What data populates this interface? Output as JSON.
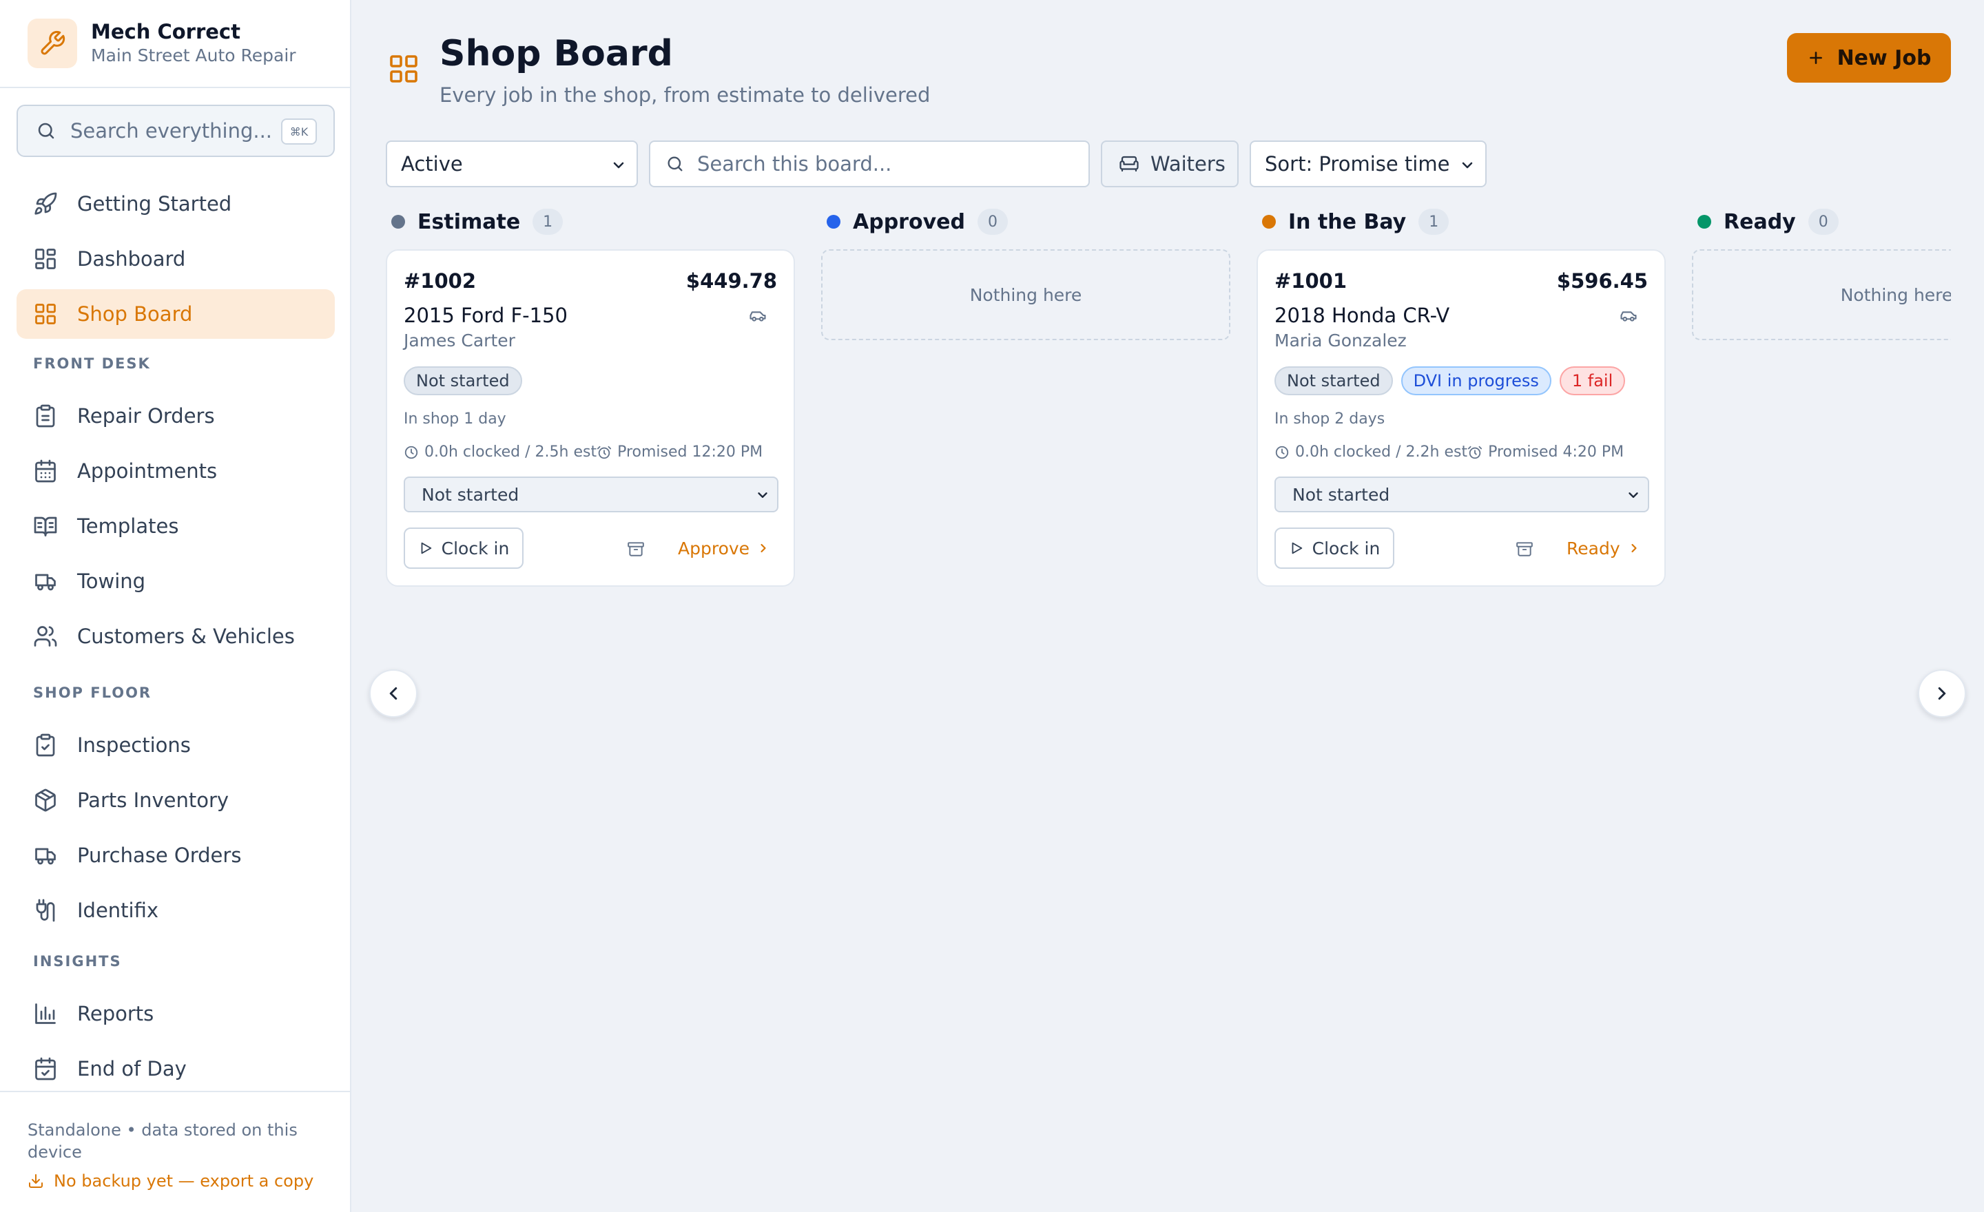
{
  "brand": {
    "name": "Mech Correct",
    "subtitle": "Main Street Auto Repair"
  },
  "sidebar": {
    "search_placeholder": "Search everything...",
    "search_shortcut": "⌘K",
    "items_top": [
      {
        "label": "Getting Started",
        "icon": "rocket-icon"
      },
      {
        "label": "Dashboard",
        "icon": "dashboard-icon"
      },
      {
        "label": "Shop Board",
        "icon": "grid-icon",
        "active": true
      }
    ],
    "sections": [
      {
        "title": "FRONT DESK",
        "items": [
          {
            "label": "Repair Orders",
            "icon": "clipboard-icon"
          },
          {
            "label": "Appointments",
            "icon": "calendar-icon"
          },
          {
            "label": "Templates",
            "icon": "book-icon"
          },
          {
            "label": "Towing",
            "icon": "truck-icon"
          },
          {
            "label": "Customers & Vehicles",
            "icon": "users-icon"
          }
        ]
      },
      {
        "title": "SHOP FLOOR",
        "items": [
          {
            "label": "Inspections",
            "icon": "clipboard-check-icon"
          },
          {
            "label": "Parts Inventory",
            "icon": "package-icon"
          },
          {
            "label": "Purchase Orders",
            "icon": "truck-icon"
          },
          {
            "label": "Identifix",
            "icon": "plug-icon"
          }
        ]
      },
      {
        "title": "INSIGHTS",
        "items": [
          {
            "label": "Reports",
            "icon": "bar-chart-icon"
          },
          {
            "label": "End of Day",
            "icon": "calendar-check-icon"
          }
        ]
      }
    ],
    "footer_note": "Standalone • data stored on this device",
    "footer_warning": "No backup yet — export a copy"
  },
  "page": {
    "title": "Shop Board",
    "subtitle": "Every job in the shop, from estimate to delivered",
    "new_job_label": "New Job"
  },
  "filters": {
    "status_value": "Active",
    "search_placeholder": "Search this board...",
    "waiters_label": "Waiters",
    "sort_value": "Sort: Promise time"
  },
  "colors": {
    "accent": "#d97706",
    "estimate": "#64748b",
    "approved": "#2563eb",
    "in_bay": "#d97706",
    "ready": "#059669"
  },
  "columns": [
    {
      "title": "Estimate",
      "count": "1",
      "color": "#64748b"
    },
    {
      "title": "Approved",
      "count": "0",
      "color": "#2563eb",
      "empty_text": "Nothing here"
    },
    {
      "title": "In the Bay",
      "count": "1",
      "color": "#d97706"
    },
    {
      "title": "Ready",
      "count": "0",
      "color": "#059669",
      "empty_text": "Nothing here"
    }
  ],
  "cards": [
    {
      "number": "#1002",
      "amount": "$449.78",
      "vehicle": "2015 Ford F-150",
      "customer": "James Carter",
      "tags": [
        "Not started"
      ],
      "in_shop": "In shop 1 day",
      "clocked": "0.0h clocked / 2.5h est",
      "promised": "Promised 12:20 PM",
      "status": "Not started",
      "clock_label": "Clock in",
      "advance_label": "Approve"
    },
    {
      "number": "#1001",
      "amount": "$596.45",
      "vehicle": "2018 Honda CR-V",
      "customer": "Maria Gonzalez",
      "tags": [
        "Not started",
        "DVI in progress",
        "1 fail"
      ],
      "in_shop": "In shop 2 days",
      "clocked": "0.0h clocked / 2.2h est",
      "promised": "Promised 4:20 PM",
      "status": "Not started",
      "clock_label": "Clock in",
      "advance_label": "Ready"
    }
  ]
}
